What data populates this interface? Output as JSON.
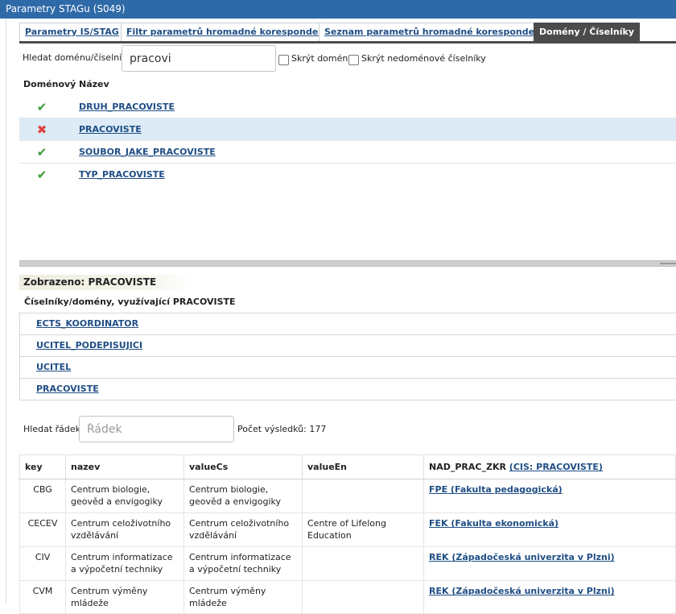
{
  "window": {
    "title": "Parametry STAGu (S049)"
  },
  "tabs": [
    {
      "label": "Parametry IS/STAG",
      "active": false
    },
    {
      "label": "Filtr parametrů hromadné korespondence",
      "active": false
    },
    {
      "label": "Seznam parametrů hromadné korespondence",
      "active": false
    },
    {
      "label": "Domény / Číselníky",
      "active": true
    }
  ],
  "search": {
    "label": "Hledat doménu/číselník:",
    "value": "pracovi",
    "hide_domains_label": "Skrýt domény",
    "hide_nondomain_label": "Skrýt nedoménové číselníky"
  },
  "domain_table": {
    "col_domain": "Doménový",
    "col_name": "Název",
    "rows": [
      {
        "is_domain": true,
        "icon": "check-icon",
        "name": "DRUH_PRACOVISTE",
        "selected": false
      },
      {
        "is_domain": false,
        "icon": "cross-icon",
        "name": "PRACOVISTE",
        "selected": true
      },
      {
        "is_domain": true,
        "icon": "check-icon",
        "name": "SOUBOR_JAKE_PRACOVISTE",
        "selected": false
      },
      {
        "is_domain": true,
        "icon": "check-icon",
        "name": "TYP_PRACOVISTE",
        "selected": false
      }
    ]
  },
  "detail": {
    "shown_label": "Zobrazeno: PRACOVISTE",
    "using_title": "Číselníky/domény, využívající PRACOVISTE",
    "using_items": [
      "ECTS_KOORDINATOR",
      "UCITEL_PODEPISUJICI",
      "UCITEL",
      "PRACOVISTE"
    ]
  },
  "row_search": {
    "label": "Hledat řádek:",
    "placeholder": "Řádek",
    "count_label": "Počet výsledků: 177"
  },
  "values_table": {
    "columns": {
      "key": "key",
      "nazev": "nazev",
      "valueCs": "valueCs",
      "valueEn": "valueEn",
      "nad_prefix": "NAD_PRAC_ZKR",
      "nad_link": "(CIS: PRACOVISTE)"
    },
    "rows": [
      {
        "key": "CBG",
        "nazev": "Centrum biologie, geověd a envigogiky",
        "valueCs": "Centrum biologie, geověd a envigogiky",
        "valueEn": "",
        "nad": "FPE (Fakulta pedagogická)"
      },
      {
        "key": "CECEV",
        "nazev": "Centrum celoživotního vzdělávání",
        "valueCs": "Centrum celoživotního vzdělávání",
        "valueEn": "Centre of Lifelong Education",
        "nad": "FEK (Fakulta ekonomická)"
      },
      {
        "key": "CIV",
        "nazev": "Centrum informatizace a výpočetní techniky",
        "valueCs": "Centrum informatizace a výpočetní techniky",
        "valueEn": "",
        "nad": "REK (Západočeská univerzita v Plzni)"
      },
      {
        "key": "CVM",
        "nazev": "Centrum výměny mládeže",
        "valueCs": "Centrum výměny mládeže",
        "valueEn": "",
        "nad": "REK (Západočeská univerzita v Plzni)"
      }
    ]
  }
}
